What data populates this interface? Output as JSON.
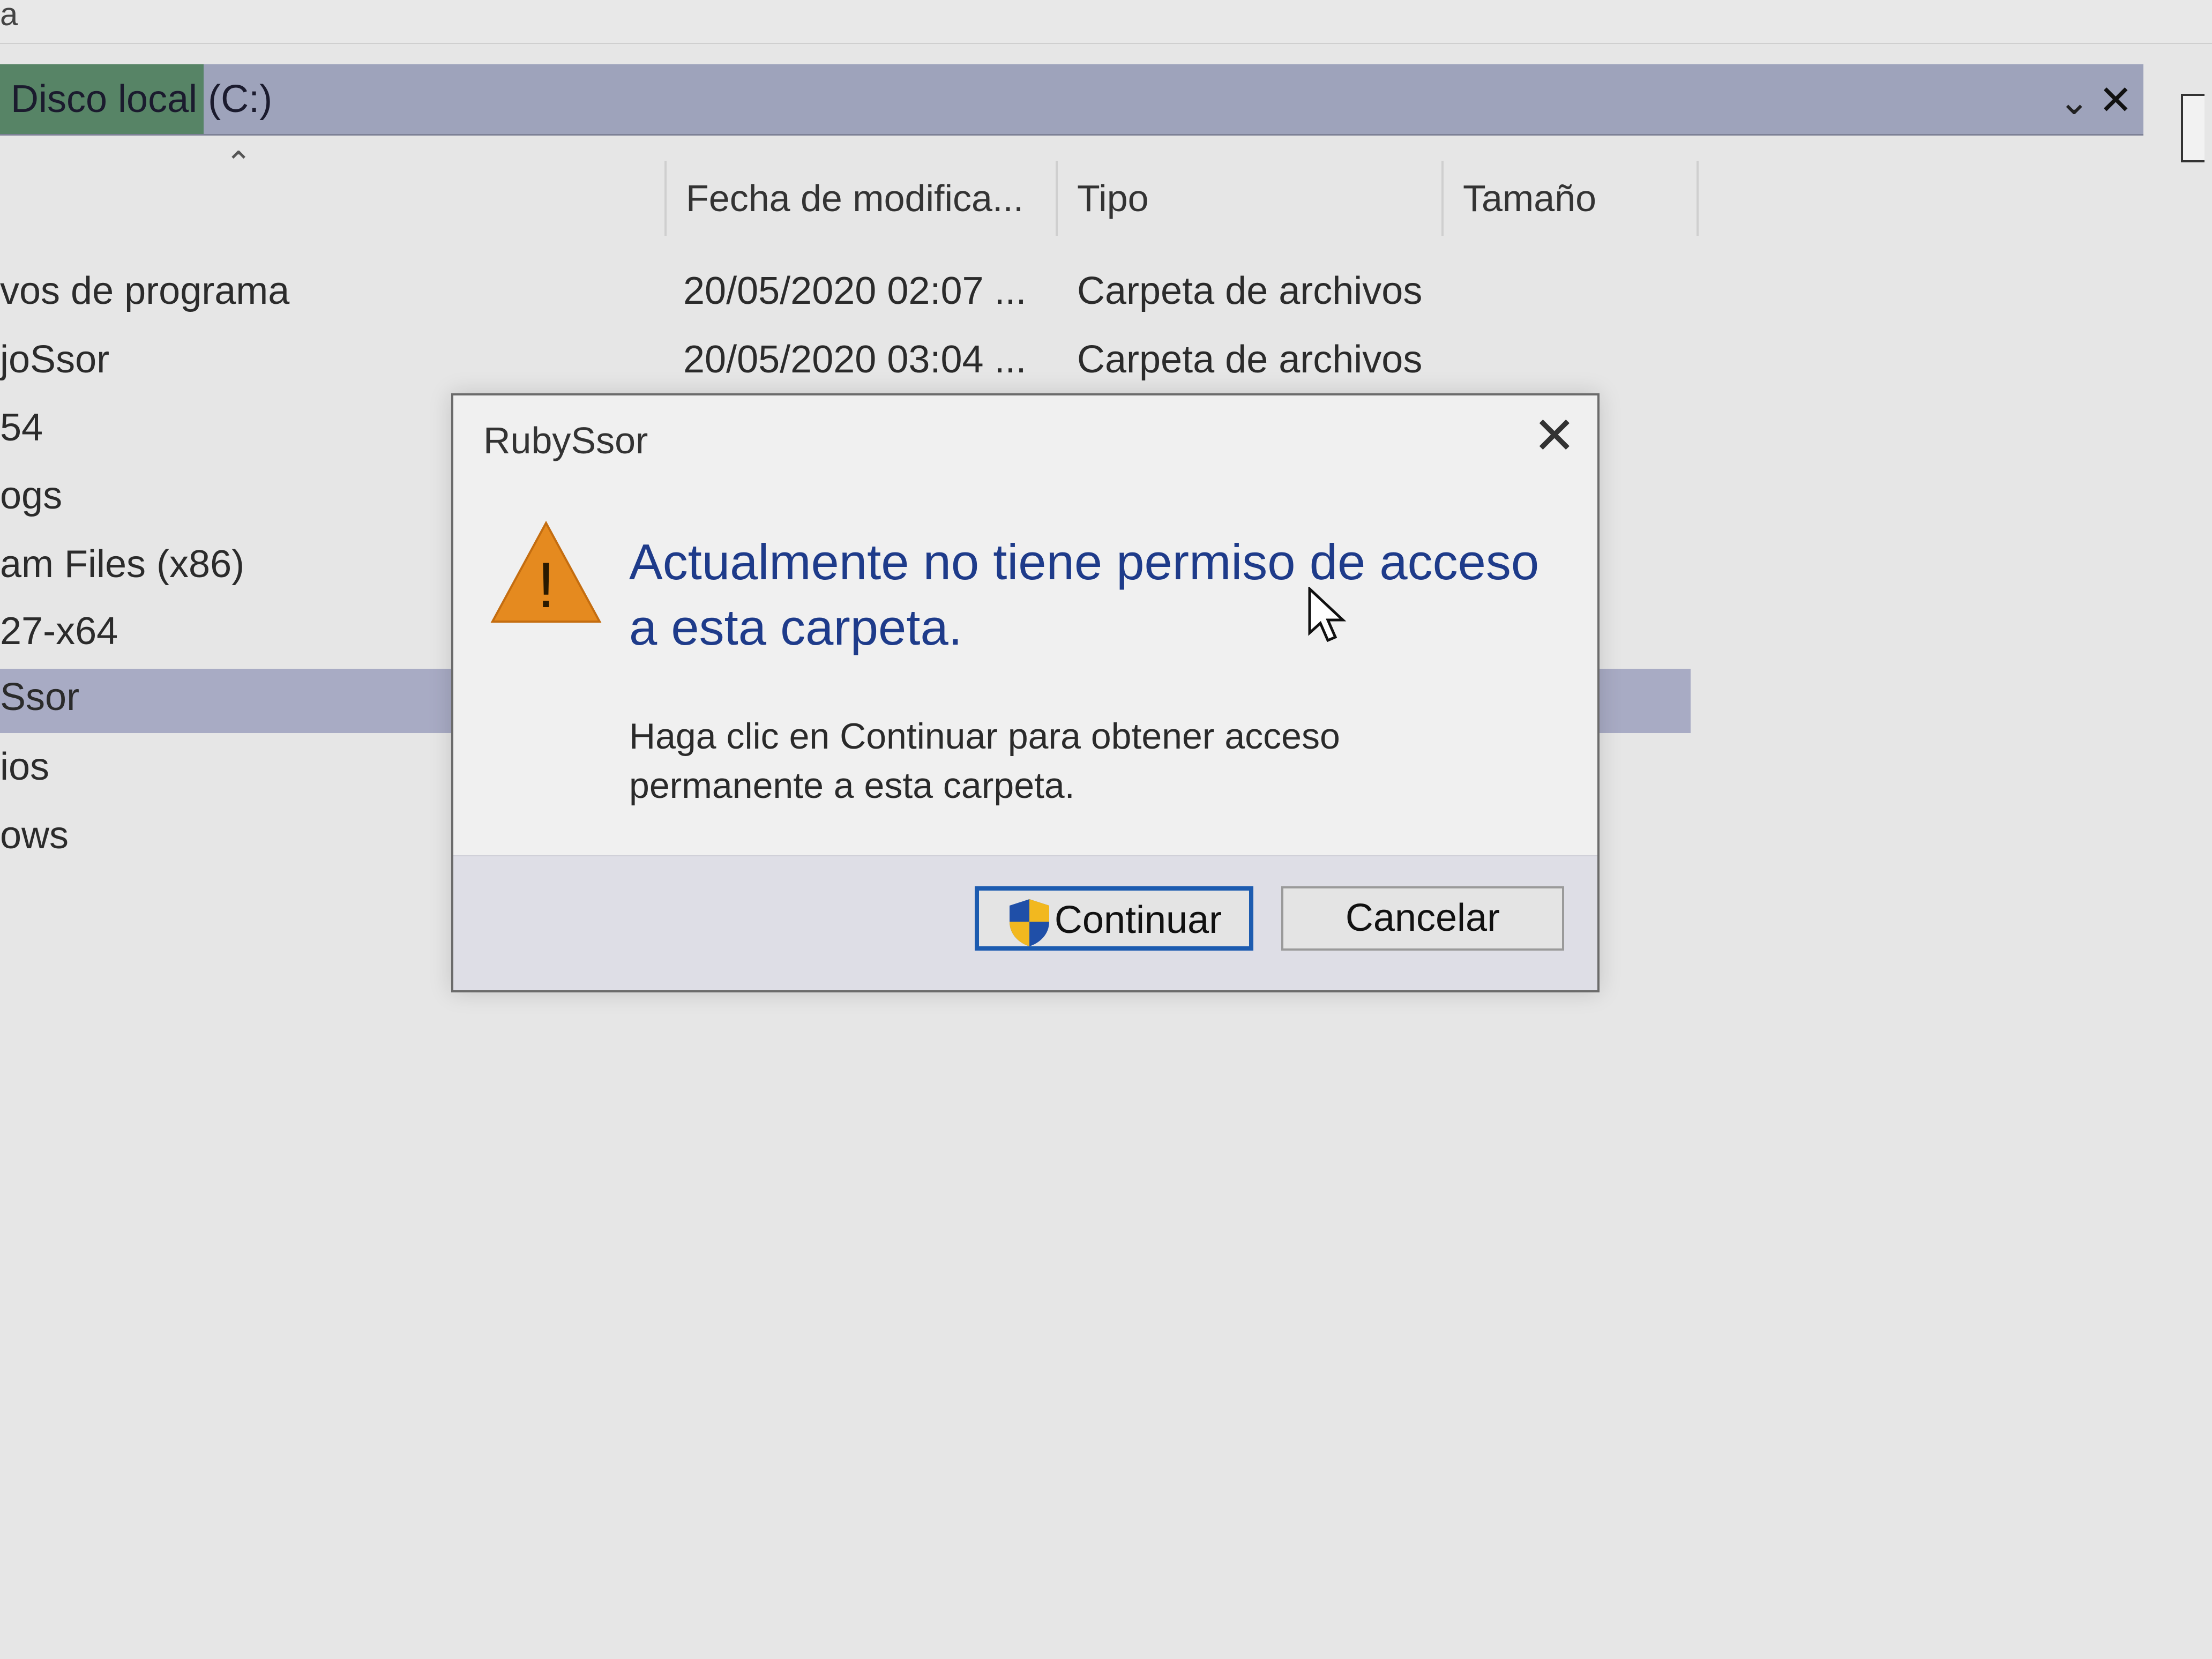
{
  "window": {
    "title_fragment": "a"
  },
  "address_bar": {
    "path": "Disco local (C:)"
  },
  "columns": {
    "date": "Fecha de modifica...",
    "type": "Tipo",
    "size": "Tamaño"
  },
  "rows": [
    {
      "name": "vos de programa",
      "date": "20/05/2020 02:07 ...",
      "type": "Carpeta de archivos"
    },
    {
      "name": "joSsor",
      "date": "20/05/2020 03:04 ...",
      "type": "Carpeta de archivos"
    },
    {
      "name": "54",
      "date": "",
      "type": ""
    },
    {
      "name": "ogs",
      "date": "",
      "type": ""
    },
    {
      "name": "am Files (x86)",
      "date": "",
      "type": ""
    },
    {
      "name": "27-x64",
      "date": "",
      "type": ""
    },
    {
      "name": "Ssor",
      "date": "",
      "type": ""
    },
    {
      "name": "ios",
      "date": "",
      "type": ""
    },
    {
      "name": "ows",
      "date": "",
      "type": ""
    }
  ],
  "dialog": {
    "title": "RubySsor",
    "close_glyph": "✕",
    "main_message": "Actualmente no tiene permiso de acceso a esta carpeta.",
    "sub_message": "Haga clic en Continuar para obtener acceso permanente a esta carpeta.",
    "continue_label": "Continuar",
    "cancel_label": "Cancelar",
    "warning_glyph": "!"
  },
  "icons": {
    "warning": "warning-triangle-icon",
    "shield": "uac-shield-icon",
    "cursor": "mouse-cursor-icon"
  },
  "colors": {
    "accent": "#1c5bb0",
    "main_message": "#1e3b8a",
    "warning": "#e58a1f",
    "selection": "#a8abc4"
  }
}
